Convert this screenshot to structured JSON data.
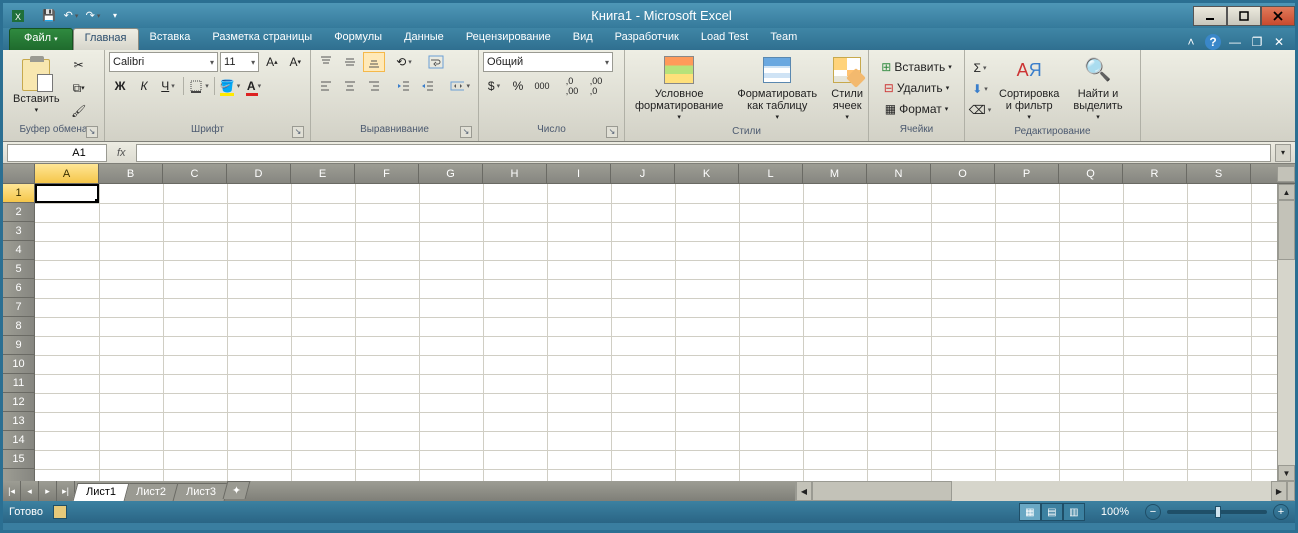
{
  "title": "Книга1 - Microsoft Excel",
  "tabs": {
    "file": "Файл",
    "items": [
      "Главная",
      "Вставка",
      "Разметка страницы",
      "Формулы",
      "Данные",
      "Рецензирование",
      "Вид",
      "Разработчик",
      "Load Test",
      "Team"
    ],
    "active": 0
  },
  "ribbon": {
    "clipboard": {
      "paste": "Вставить",
      "label": "Буфер обмена"
    },
    "font": {
      "name": "Calibri",
      "size": "11",
      "bold": "Ж",
      "italic": "К",
      "underline": "Ч",
      "label": "Шрифт"
    },
    "align": {
      "label": "Выравнивание"
    },
    "number": {
      "format": "Общий",
      "currency": "$",
      "percent": "%",
      "comma": "000",
      "label": "Число"
    },
    "styles": {
      "conditional": "Условное\nформатирование",
      "as_table": "Форматировать\nкак таблицу",
      "cell_styles": "Стили\nячеек",
      "label": "Стили"
    },
    "cells": {
      "insert": "Вставить",
      "delete": "Удалить",
      "format": "Формат",
      "label": "Ячейки"
    },
    "editing": {
      "sort": "Сортировка\nи фильтр",
      "find": "Найти и\nвыделить",
      "label": "Редактирование"
    }
  },
  "formula_bar": {
    "cell_ref": "A1",
    "formula": ""
  },
  "grid": {
    "columns": [
      "A",
      "B",
      "C",
      "D",
      "E",
      "F",
      "G",
      "H",
      "I",
      "J",
      "K",
      "L",
      "M",
      "N",
      "O",
      "P",
      "Q",
      "R",
      "S"
    ],
    "rows": [
      "1",
      "2",
      "3",
      "4",
      "5",
      "6",
      "7",
      "8",
      "9",
      "10",
      "11",
      "12",
      "13",
      "14",
      "15"
    ],
    "active_col": 0,
    "active_row": 0
  },
  "sheets": {
    "items": [
      "Лист1",
      "Лист2",
      "Лист3"
    ],
    "active": 0
  },
  "status": {
    "ready": "Готово",
    "zoom": "100%"
  }
}
